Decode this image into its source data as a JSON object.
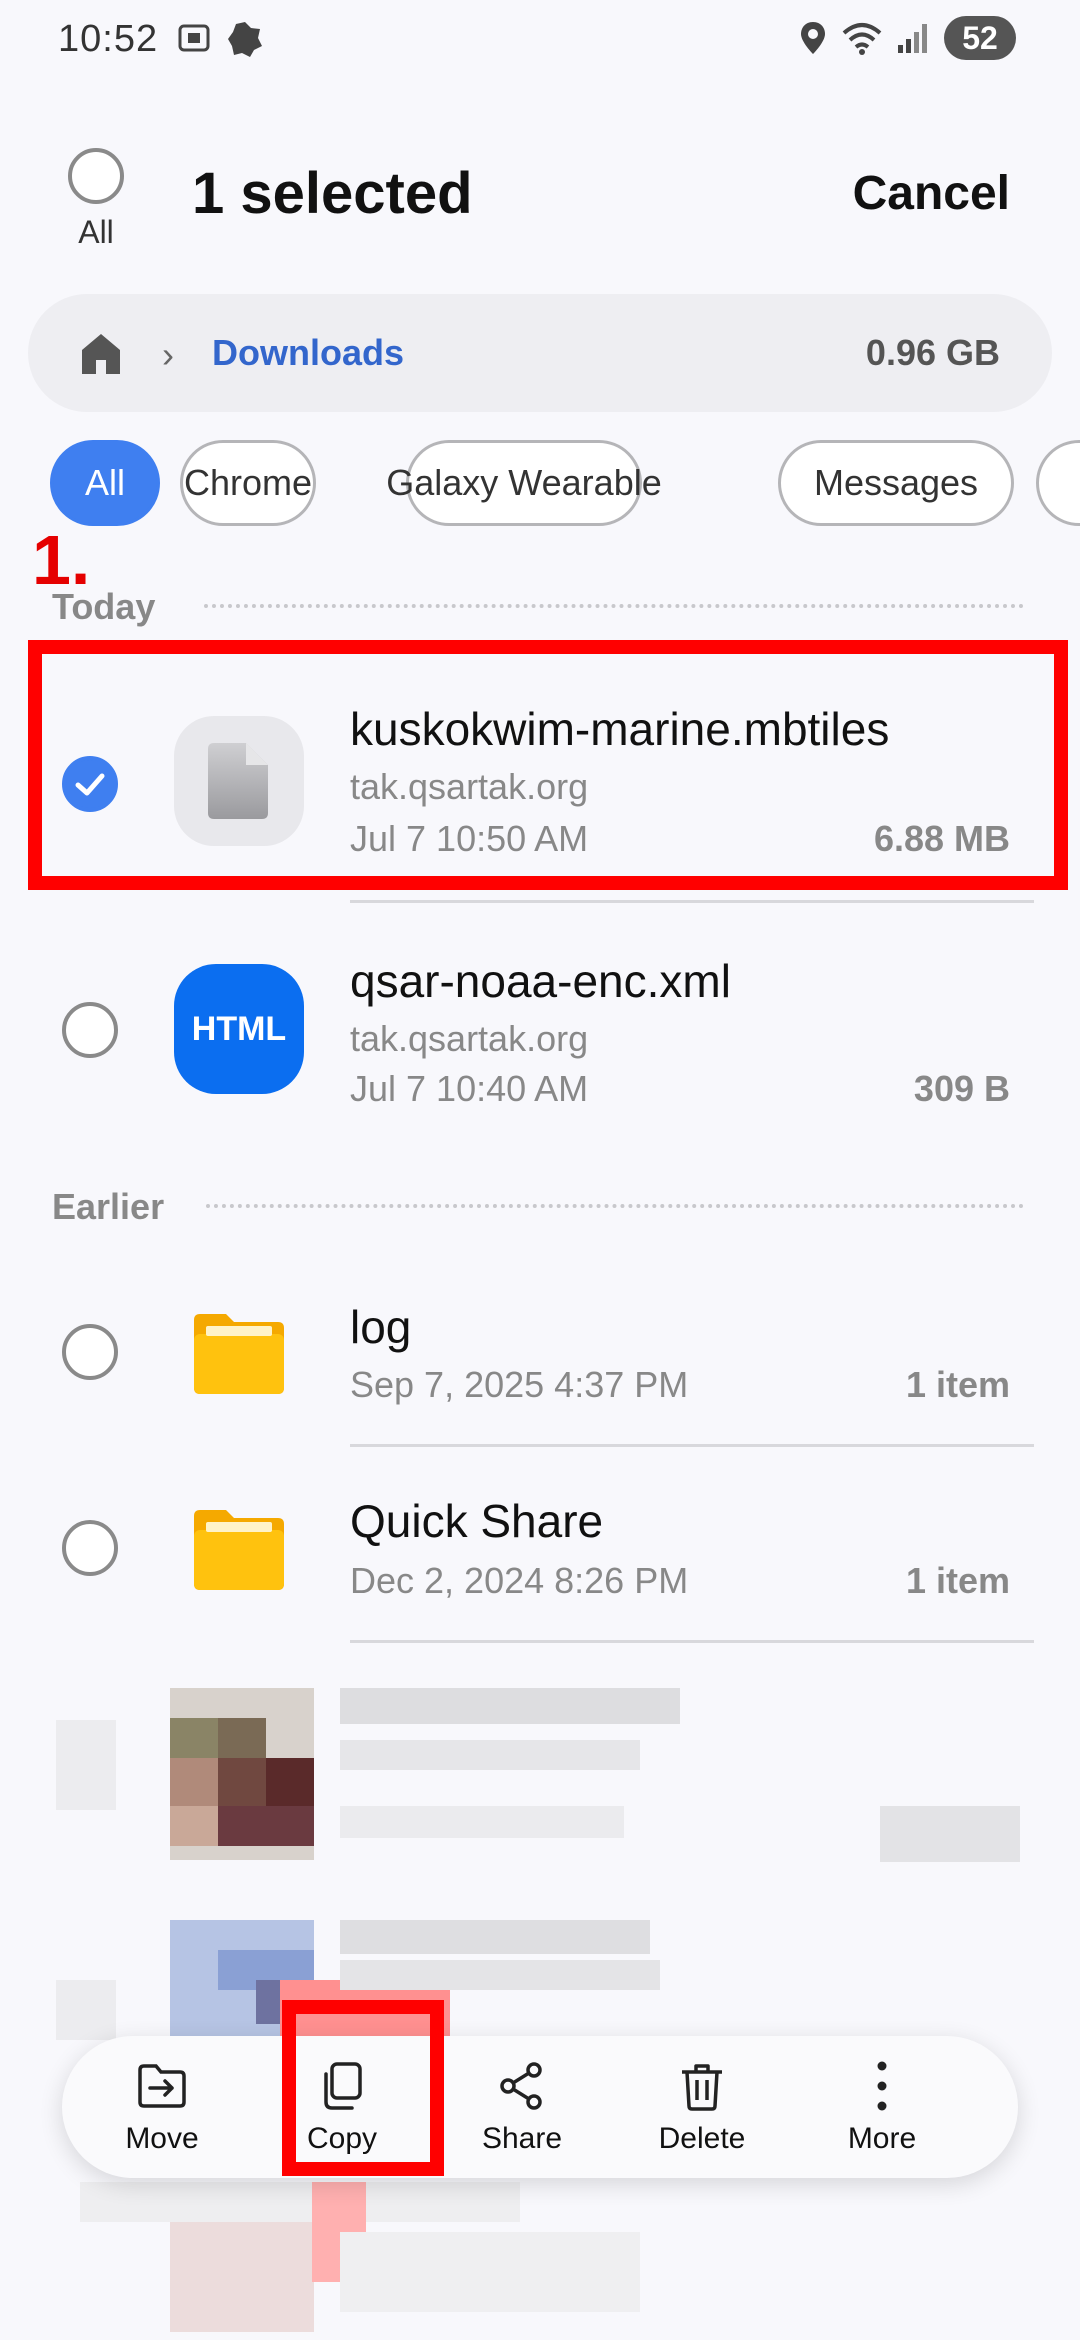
{
  "status_bar": {
    "time": "10:52",
    "battery": "52"
  },
  "header": {
    "all_label": "All",
    "title": "1 selected",
    "cancel_label": "Cancel"
  },
  "breadcrumb": {
    "folder": "Downloads",
    "storage": "0.96 GB"
  },
  "chips": [
    "All",
    "Chrome",
    "Galaxy Wearable",
    "Messages"
  ],
  "annotation": {
    "step_label": "1."
  },
  "sections": {
    "today": "Today",
    "earlier": "Earlier"
  },
  "files": [
    {
      "name": "kuskokwim-marine.mbtiles",
      "source": "tak.qsartak.org",
      "date": "Jul 7 10:50 AM",
      "size": "6.88 MB",
      "selected": true
    },
    {
      "name": "qsar-noaa-enc.xml",
      "source": "tak.qsartak.org",
      "date": "Jul 7 10:40 AM",
      "size": "309 B",
      "icon_text": "HTML",
      "selected": false
    }
  ],
  "folders": [
    {
      "name": "log",
      "date": "Sep 7, 2025 4:37 PM",
      "count": "1 item"
    },
    {
      "name": "Quick Share",
      "date": "Dec 2, 2024 8:26 PM",
      "count": "1 item"
    }
  ],
  "actions": {
    "move": "Move",
    "copy": "Copy",
    "share": "Share",
    "delete": "Delete",
    "more": "More"
  },
  "colors": {
    "accent": "#3f7ff0",
    "annotation": "#ff0000",
    "folder": "#ffc20e"
  }
}
